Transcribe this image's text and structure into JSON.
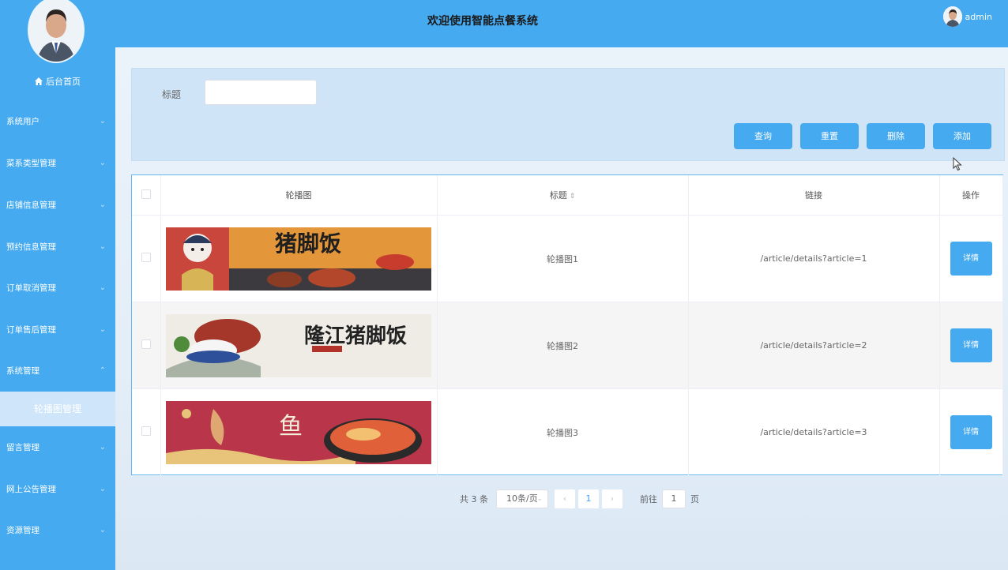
{
  "header": {
    "title": "欢迎使用智能点餐系统",
    "username": "admin"
  },
  "sidebar": {
    "home_label": "后台首页",
    "items": [
      {
        "label": "系统用户"
      },
      {
        "label": "菜系类型管理"
      },
      {
        "label": "店铺信息管理"
      },
      {
        "label": "预约信息管理"
      },
      {
        "label": "订单取消管理"
      },
      {
        "label": "订单售后管理"
      },
      {
        "label": "系统管理",
        "expanded": true
      },
      {
        "label": "留言管理"
      },
      {
        "label": "网上公告管理"
      },
      {
        "label": "资源管理"
      }
    ],
    "active_sub_item": "轮播图管理"
  },
  "search": {
    "title_label": "标题",
    "title_value": ""
  },
  "actions": {
    "query": "查询",
    "reset": "重置",
    "delete": "删除",
    "add": "添加"
  },
  "table": {
    "columns": {
      "image": "轮播图",
      "title": "标题",
      "link": "链接",
      "actions": "操作"
    },
    "rows": [
      {
        "title": "轮播图1",
        "link": "/article/details?article=1",
        "action": "详情",
        "banner_text": "猪脚饭"
      },
      {
        "title": "轮播图2",
        "link": "/article/details?article=2",
        "action": "详情",
        "banner_text": "隆江猪脚饭"
      },
      {
        "title": "轮播图3",
        "link": "/article/details?article=3",
        "action": "详情",
        "banner_text": "鱼"
      }
    ]
  },
  "pagination": {
    "total": "共 3 条",
    "page_size": "10条/页",
    "current_page": "1",
    "goto_label": "前往",
    "goto_value": "1",
    "page_suffix": "页"
  },
  "colors": {
    "primary": "#45aaf0",
    "sidebar": "#45aaf0"
  }
}
